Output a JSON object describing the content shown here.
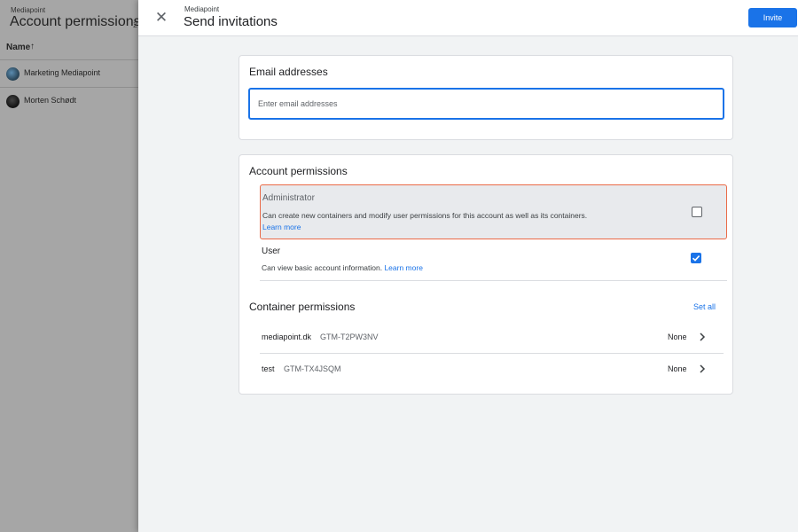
{
  "background_page": {
    "breadcrumb": "Mediapoint",
    "title": "Account permissions",
    "count": "2",
    "column_header": "Name",
    "sort_icon": "arrow-up-icon",
    "rows": [
      {
        "name": "Marketing Mediapoint"
      },
      {
        "name": "Morten Schødt"
      }
    ]
  },
  "dialog": {
    "breadcrumb": "Mediapoint",
    "title": "Send invitations",
    "close_icon": "close-icon",
    "invite_label": "Invite",
    "accent_color": "#1a73e8",
    "email_section": {
      "title": "Email addresses",
      "input_value": "",
      "input_placeholder": "Enter email addresses"
    },
    "account_permissions": {
      "title": "Account permissions",
      "roles": [
        {
          "name": "Administrator",
          "description": "Can create new containers and modify user permissions for this account as well as its containers.",
          "learn_more": "Learn more",
          "checked": false
        },
        {
          "name": "User",
          "description": "Can view basic account information.",
          "learn_more": "Learn more",
          "checked": true
        }
      ]
    },
    "container_permissions": {
      "title": "Container permissions",
      "set_all_label": "Set all",
      "containers": [
        {
          "name": "mediapoint.dk",
          "id": "GTM-T2PW3NV",
          "permission": "None"
        },
        {
          "name": "test",
          "id": "GTM-TX4JSQM",
          "permission": "None"
        }
      ]
    }
  }
}
